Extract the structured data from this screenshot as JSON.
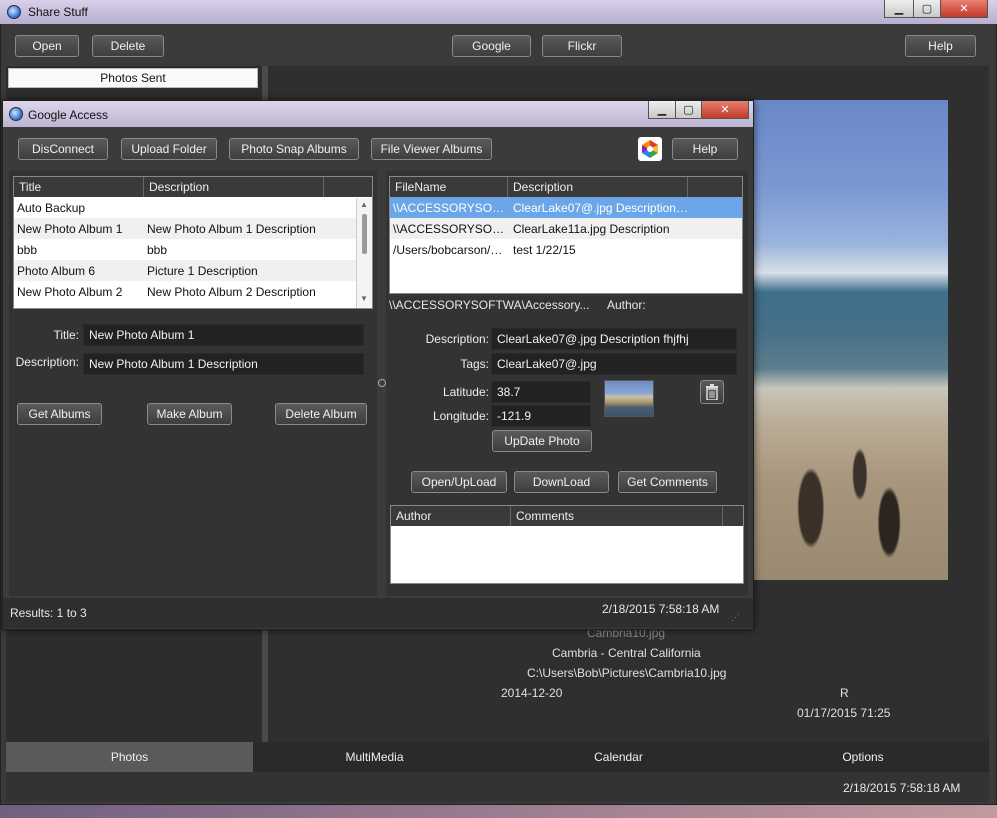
{
  "main_window": {
    "title": "Share Stuff",
    "toolbar": {
      "open": "Open",
      "delete": "Delete",
      "google": "Google",
      "flickr": "Flickr",
      "help": "Help"
    },
    "left_header": "Photos Sent",
    "photo_meta": {
      "filename": "Cambria10.jpg",
      "description": "Cambria - Central California",
      "path": "C:\\Users\\Bob\\Pictures\\Cambria10.jpg",
      "date": "2014-12-20",
      "flag": "R",
      "timestamp": "01/17/2015 71:25"
    },
    "tabs": [
      "Photos",
      "MultiMedia",
      "Calendar",
      "Options"
    ],
    "active_tab": "Photos",
    "status_time": "2/18/2015 7:58:18 AM"
  },
  "dialog": {
    "title": "Google Access",
    "toolbar": {
      "disconnect": "DisConnect",
      "upload_folder": "Upload Folder",
      "photo_snap": "Photo Snap Albums",
      "file_viewer": "File Viewer Albums",
      "help": "Help"
    },
    "albums_table": {
      "headers": [
        "Title",
        "Description"
      ],
      "rows": [
        {
          "title": "Auto Backup",
          "description": ""
        },
        {
          "title": "New Photo Album 1",
          "description": "New Photo Album 1 Description"
        },
        {
          "title": "bbb",
          "description": "bbb"
        },
        {
          "title": "Photo Album 6",
          "description": "Picture 1 Description"
        },
        {
          "title": "New Photo Album 2",
          "description": "New Photo Album 2 Description"
        }
      ]
    },
    "album_form": {
      "title_label": "Title:",
      "title_value": "New Photo Album 1",
      "description_label": "Description:",
      "description_value": "New Photo Album 1 Description",
      "get_albums": "Get Albums",
      "make_album": "Make Album",
      "delete_album": "Delete Album"
    },
    "files_table": {
      "headers": [
        "FileName",
        "Description"
      ],
      "rows": [
        {
          "filename": "\\\\ACCESSORYSOFT...",
          "description": "ClearLake07@.jpg Description f..."
        },
        {
          "filename": "\\\\ACCESSORYSOFT...",
          "description": "ClearLake11a.jpg Description"
        },
        {
          "filename": "/Users/bobcarson/Pi...",
          "description": "test 1/22/15"
        }
      ]
    },
    "selected_path": "\\\\ACCESSORYSOFTWA\\Accessory...",
    "author_label": "Author:",
    "photo_form": {
      "description_label": "Description:",
      "description_value": "ClearLake07@.jpg Description fhjfhj",
      "tags_label": "Tags:",
      "tags_value": "ClearLake07@.jpg",
      "latitude_label": "Latitude:",
      "latitude_value": "38.7",
      "longitude_label": "Longitude:",
      "longitude_value": "-121.9",
      "update_photo": "UpDate Photo"
    },
    "actions": {
      "open_upload": "Open/UpLoad",
      "download": "DownLoad",
      "get_comments": "Get Comments"
    },
    "comments_table": {
      "headers": [
        "Author",
        "Comments"
      ]
    },
    "status_results": "Results: 1 to 3",
    "status_time": "2/18/2015 7:58:18 AM"
  }
}
